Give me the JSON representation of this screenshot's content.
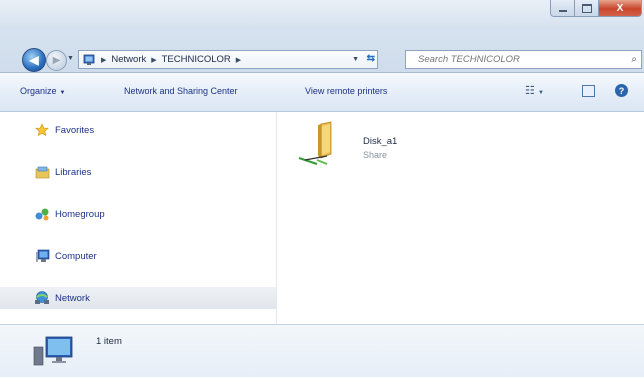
{
  "window": {
    "close_glyph": "X"
  },
  "address_bar": {
    "crumbs": [
      "Network",
      "TECHNICOLOR"
    ]
  },
  "search": {
    "placeholder": "Search TECHNICOLOR"
  },
  "command_bar": {
    "organize": "Organize",
    "network_sharing": "Network and Sharing Center",
    "view_remote_printers": "View remote printers"
  },
  "nav_pane": {
    "items": [
      {
        "label": "Favorites",
        "icon": "star-icon"
      },
      {
        "label": "Libraries",
        "icon": "libraries-icon"
      },
      {
        "label": "Homegroup",
        "icon": "homegroup-icon"
      },
      {
        "label": "Computer",
        "icon": "computer-icon"
      },
      {
        "label": "Network",
        "icon": "network-icon",
        "selected": true
      }
    ]
  },
  "content": {
    "items": [
      {
        "name": "Disk_a1",
        "type": "Share",
        "icon": "shared-folder-icon"
      }
    ]
  },
  "details_pane": {
    "count": "1 item"
  },
  "colors": {
    "link_text": "#1e3287",
    "close_button": "#c8452b",
    "frame": "#d6e2ef"
  }
}
